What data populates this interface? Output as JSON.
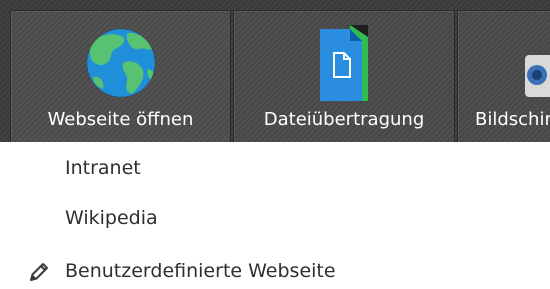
{
  "toolbar": {
    "buttons": [
      {
        "label": "Webseite öffnen",
        "icon": "globe-icon"
      },
      {
        "label": "Dateiübertragung",
        "icon": "file-transfer-icon"
      },
      {
        "label": "Bildschirm",
        "icon": "screen-icon"
      }
    ]
  },
  "menu": {
    "items": [
      {
        "label": "Intranet"
      },
      {
        "label": "Wikipedia"
      },
      {
        "label": "Benutzerdefinierte Webseite",
        "icon": "pencil-icon"
      }
    ]
  },
  "colors": {
    "toolbar_bg": "#3a3a3a",
    "button_bg": "#474747",
    "globe_blue": "#1e8fd8",
    "globe_green": "#57c271",
    "file_blue": "#2a8de0",
    "file_green": "#2ebd4f",
    "menu_text": "#2f2f2f"
  }
}
